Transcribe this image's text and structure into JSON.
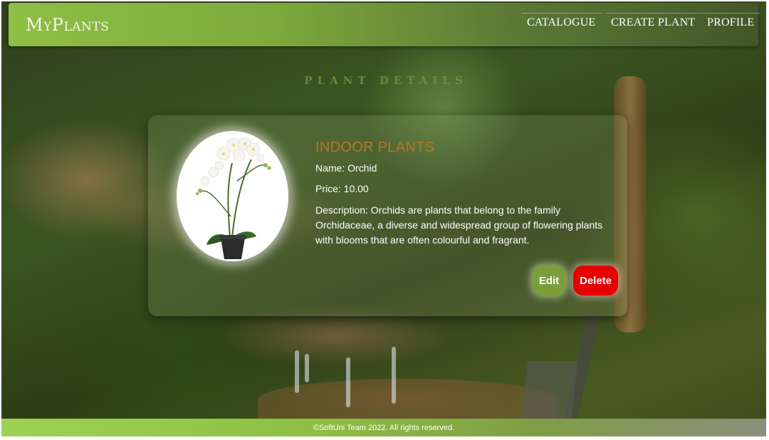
{
  "header": {
    "logo": "MyPlants",
    "nav": {
      "catalogue": "CATALOGUE",
      "create_plant": "CREATE PLANT",
      "profile": "PROFILE"
    }
  },
  "main": {
    "section_title": "PLANT DETAILS",
    "plant": {
      "category": "INDOOR PLANTS",
      "name_line": "Name: Orchid",
      "price_line": "Price: 10.00",
      "description_line": "Description: Orchids are plants that belong to the family Orchidaceae, a diverse and widespread group of flowering plants with blooms that are often colourful and fragrant.",
      "image_icon": "orchid-photo"
    },
    "actions": {
      "edit_label": "Edit",
      "delete_label": "Delete"
    }
  },
  "footer": {
    "copyright": "©SoftUni Team 2022. All rights reserved."
  },
  "colors": {
    "header_green": "#8fbf45",
    "category_text": "#b07a2a",
    "edit_button": "#7a9e3a",
    "delete_button": "#e60000"
  }
}
